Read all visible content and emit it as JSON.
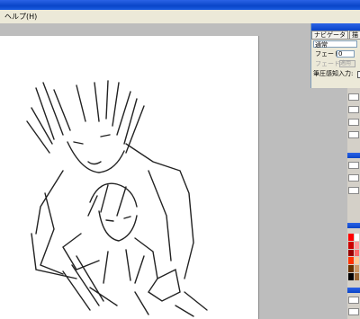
{
  "menubar": {
    "help_label": "ヘルプ(H)"
  },
  "navigator": {
    "tabs": [
      "ナビゲータ",
      "描"
    ],
    "blend_mode": "通常",
    "fade_label": "フェード:",
    "fade_value": "0",
    "fade_button_label": "フェード",
    "fade_button_value": "適用",
    "pressure_label": "筆圧感知入力:"
  },
  "palette_colors": [
    "#ff0000",
    "#ffffff",
    "#cc0000",
    "#ff9999",
    "#990000",
    "#ff6666",
    "#ff3300",
    "#ffcc99",
    "#663300",
    "#cc9966",
    "#000000",
    "#996633"
  ]
}
